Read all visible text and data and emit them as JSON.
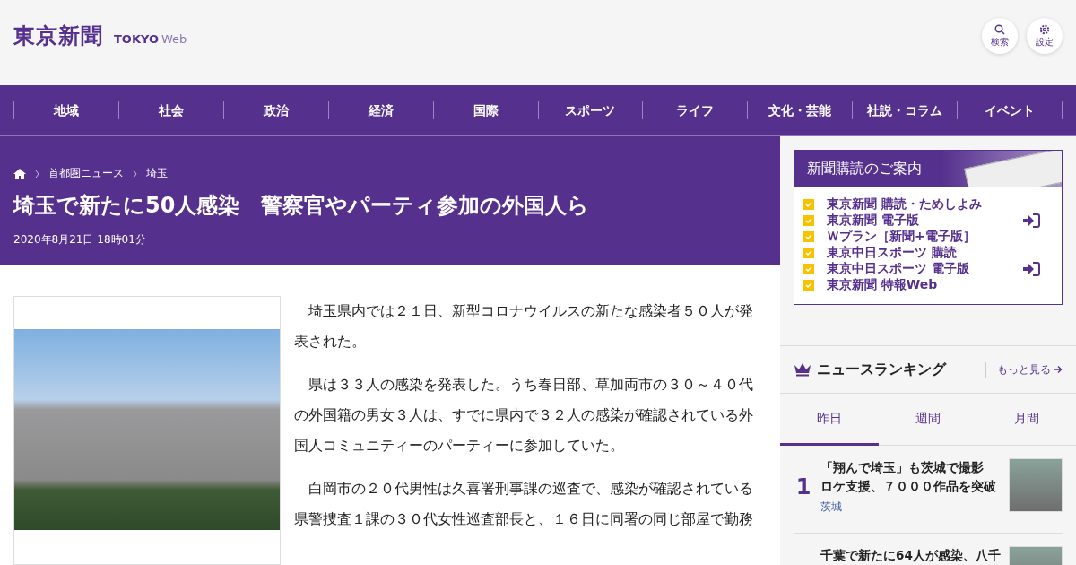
{
  "header": {
    "logo": "東京新聞",
    "logo_sub_bold": "TOKYO",
    "logo_sub": "Web",
    "buttons": [
      {
        "kind": "search",
        "label": "検索"
      },
      {
        "kind": "settings",
        "label": "設定"
      }
    ]
  },
  "nav": [
    "地域",
    "社会",
    "政治",
    "経済",
    "国際",
    "スポーツ",
    "ライフ",
    "文化・芸能",
    "社説・コラム",
    "イベント"
  ],
  "breadcrumb": [
    "首都圏ニュース",
    "埼玉"
  ],
  "article": {
    "title": "埼玉で新たに50人感染　警察官やパーティ参加の外国人ら",
    "date": "2020年8月21日 18時01分",
    "paragraphs": [
      "埼玉県内では２１日、新型コロナウイルスの新たな感染者５０人が発表された。",
      "県は３３人の感染を発表した。うち春日部、草加両市の３０～４０代の外国籍の男女３人は、すでに県内で３２人の感染が確認されている外国人コミュニティーのパーティーに参加していた。",
      "白岡市の２０代男性は久喜署刑事課の巡査で、感染が確認されている県警捜査１課の３０代女性巡査部長と、１６日に同署の同じ部屋で勤務"
    ]
  },
  "subscription": {
    "title": "新聞購読のご案内",
    "items": [
      {
        "label": "東京新聞 購読・ためしよみ",
        "link_icon": false
      },
      {
        "label": "東京新聞 電子版",
        "link_icon": true
      },
      {
        "label": "Ｗプラン［新聞+電子版］",
        "link_icon": false
      },
      {
        "label": "東京中日スポーツ 購読",
        "link_icon": false
      },
      {
        "label": "東京中日スポーツ 電子版",
        "link_icon": true
      },
      {
        "label": "東京新聞 特報Web",
        "link_icon": false
      }
    ]
  },
  "ranking": {
    "title": "ニュースランキング",
    "more": "もっと見る",
    "tabs": [
      {
        "label": "昨日",
        "selected": true
      },
      {
        "label": "週間",
        "selected": false
      },
      {
        "label": "月間",
        "selected": false
      }
    ],
    "items": [
      {
        "rank": "1",
        "title_lines": [
          "「翔んで埼玉」も茨城で撮影",
          "ロケ支援、７０００作品を突破"
        ],
        "category": "茨城"
      },
      {
        "title_lines": [
          "千葉で新たに64人が感染、八千"
        ]
      }
    ]
  }
}
